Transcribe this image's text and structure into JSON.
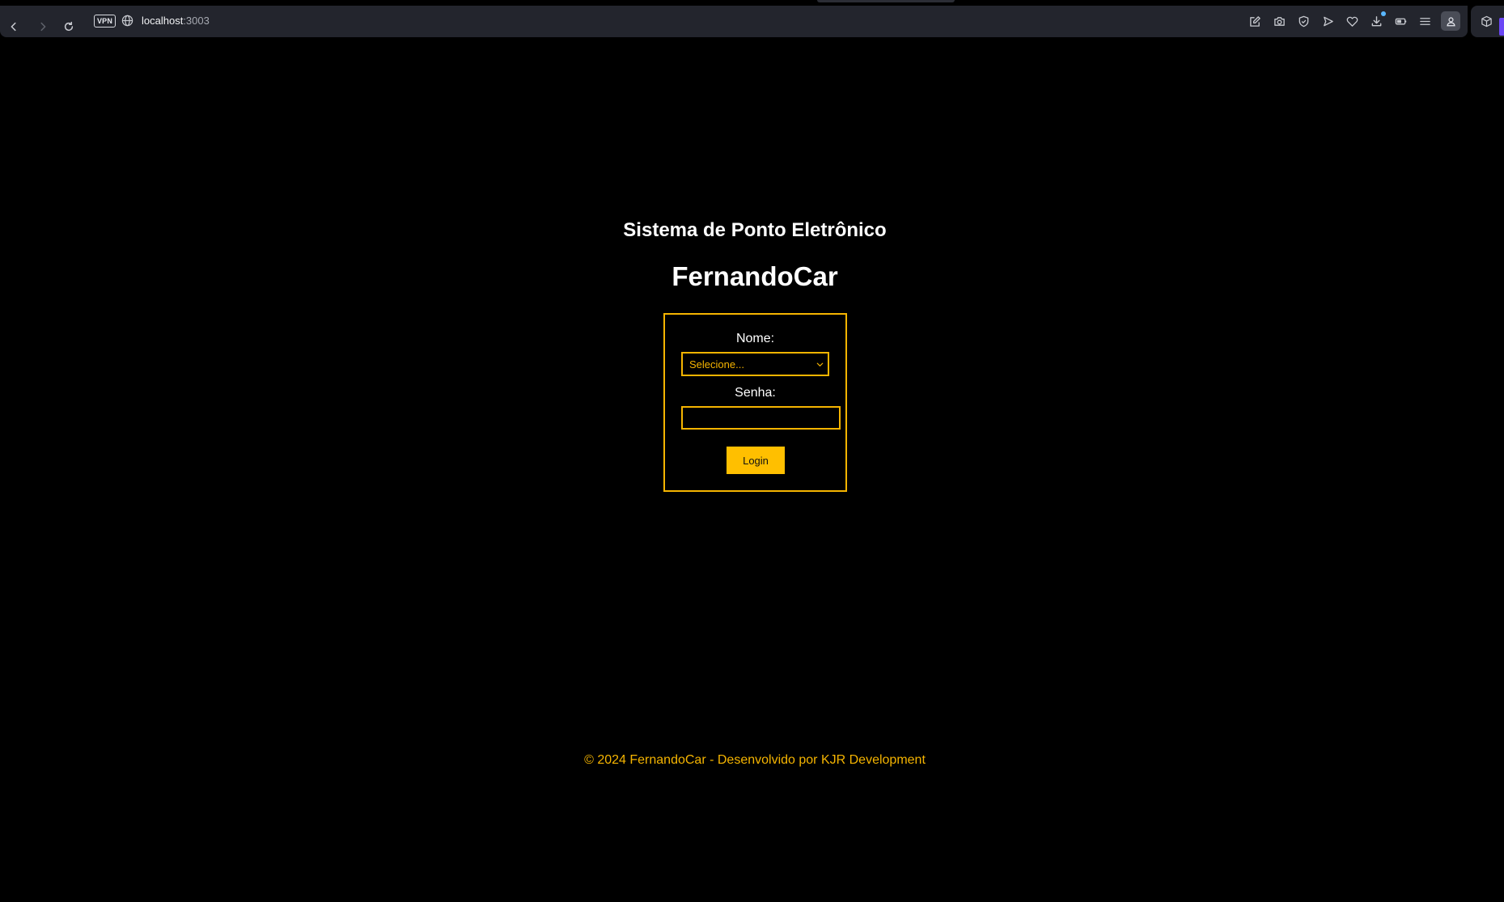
{
  "browser": {
    "url_host": "localhost",
    "url_port": ":3003",
    "vpn_label": "VPN",
    "toolbar_icons": [
      "edit-icon",
      "camera-icon",
      "shield-icon",
      "send-icon",
      "heart-icon",
      "download-icon",
      "battery-icon",
      "menu-icon",
      "profile-icon",
      "cube-icon"
    ]
  },
  "page": {
    "subtitle": "Sistema de Ponto Eletrônico",
    "brand": "FernandoCar"
  },
  "login_form": {
    "name_label": "Nome:",
    "name_select_value": "Selecione...",
    "password_label": "Senha:",
    "password_value": "",
    "login_button": "Login"
  },
  "footer": {
    "text": "© 2024 FernandoCar - Desenvolvido por KJR Development"
  },
  "colors": {
    "background": "#000000",
    "accent": "#f5b400",
    "button": "#ffbf00",
    "text": "#ffffff"
  }
}
